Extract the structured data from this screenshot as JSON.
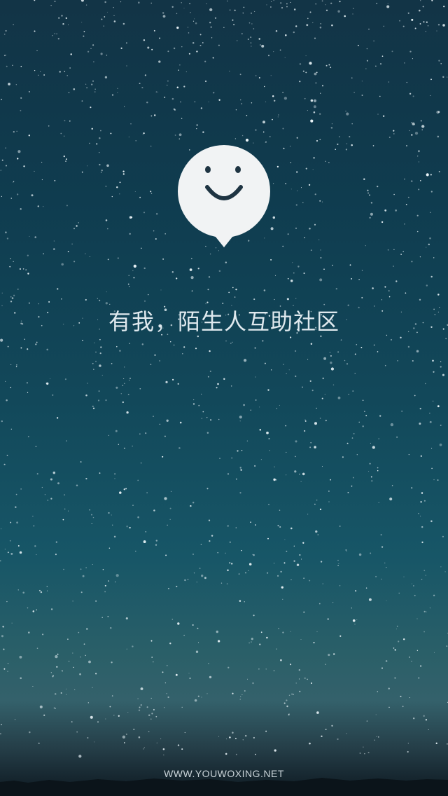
{
  "splash": {
    "tagline": "有我，陌生人互助社区",
    "footer_text": "WWW.YOUWOXING.NET"
  },
  "logo": {
    "icon": "smiley-speech-bubble-icon",
    "color": "#f1f3f4",
    "face_color": "#1e3442"
  },
  "colors": {
    "sky_top": "#123446",
    "sky_mid": "#175667",
    "horizon_glow": "#34616b",
    "ground": "#0d1820"
  }
}
